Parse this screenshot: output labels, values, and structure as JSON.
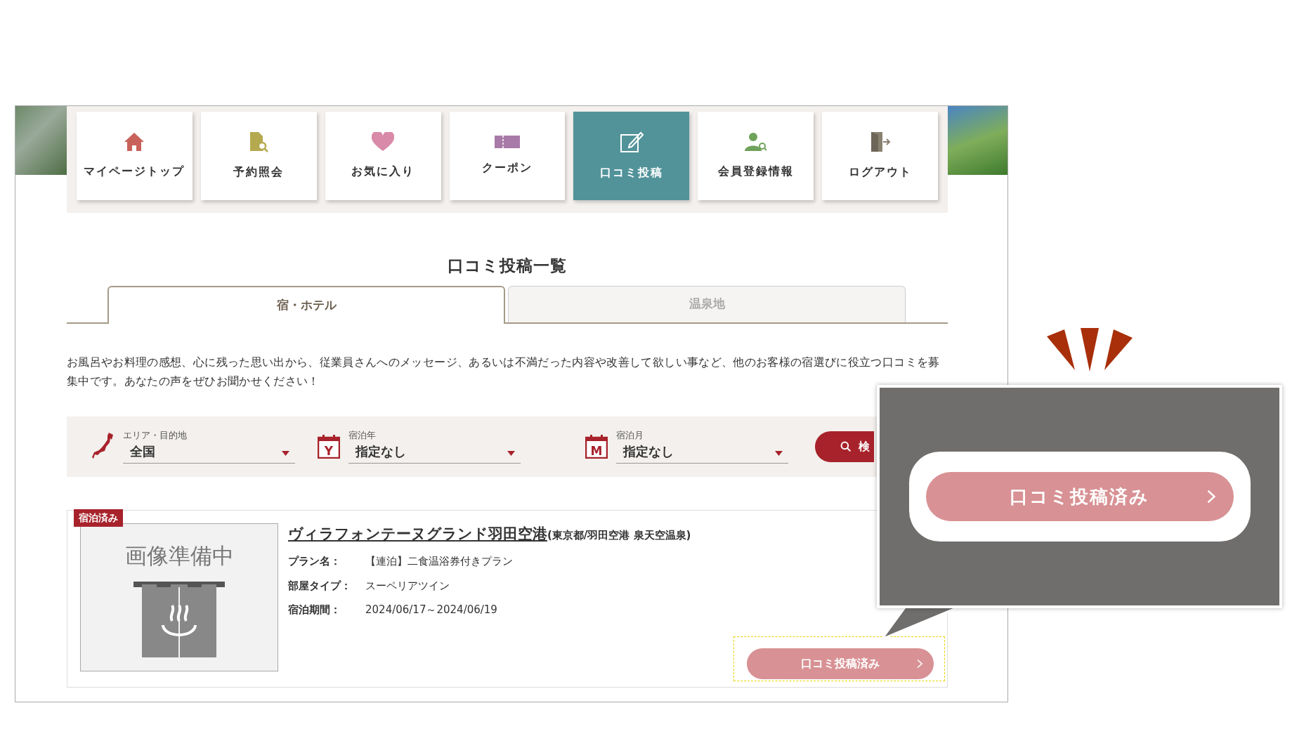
{
  "nav": [
    {
      "label": "マイページトップ",
      "selected": false
    },
    {
      "label": "予約照会",
      "selected": false
    },
    {
      "label": "お気に入り",
      "selected": false
    },
    {
      "label": "クーポン",
      "selected": false
    },
    {
      "label": "口コミ投稿",
      "selected": true
    },
    {
      "label": "会員登録情報",
      "selected": false
    },
    {
      "label": "ログアウト",
      "selected": false
    }
  ],
  "heading": "口コミ投稿一覧",
  "tabs": [
    {
      "label": "宿・ホテル",
      "selected": true
    },
    {
      "label": "温泉地",
      "selected": false
    }
  ],
  "intro": "お風呂やお料理の感想、心に残った思い出から、従業員さんへのメッセージ、あるいは不満だった内容や改善して欲しい事など、他のお客様の宿選びに役立つ口コミを募集中です。あなたの声をぜひお聞かせください！",
  "filters": [
    {
      "kind": "area",
      "label": "エリア・目的地",
      "value": "全国"
    },
    {
      "kind": "year",
      "icon_text": "Y",
      "label": "宿泊年",
      "value": "指定なし"
    },
    {
      "kind": "month",
      "icon_text": "M",
      "label": "宿泊月",
      "value": "指定なし"
    }
  ],
  "search_button": "検",
  "review": {
    "badge": "宿泊済み",
    "image_text": "画像準備中",
    "name": "ヴィラフォンテーヌグランド羽田空港",
    "location": "(東京都/羽田空港 泉天空温泉)",
    "fields": [
      {
        "label": "プラン名：",
        "value": "【連泊】二食温浴券付きプラン"
      },
      {
        "label": "部屋タイプ：",
        "value": "スーペリアツイン"
      },
      {
        "label": "宿泊期間：",
        "value": "2024/06/17～2024/06/19"
      }
    ],
    "button": "口コミ投稿済み"
  },
  "callout": {
    "button": "口コミ投稿済み"
  }
}
